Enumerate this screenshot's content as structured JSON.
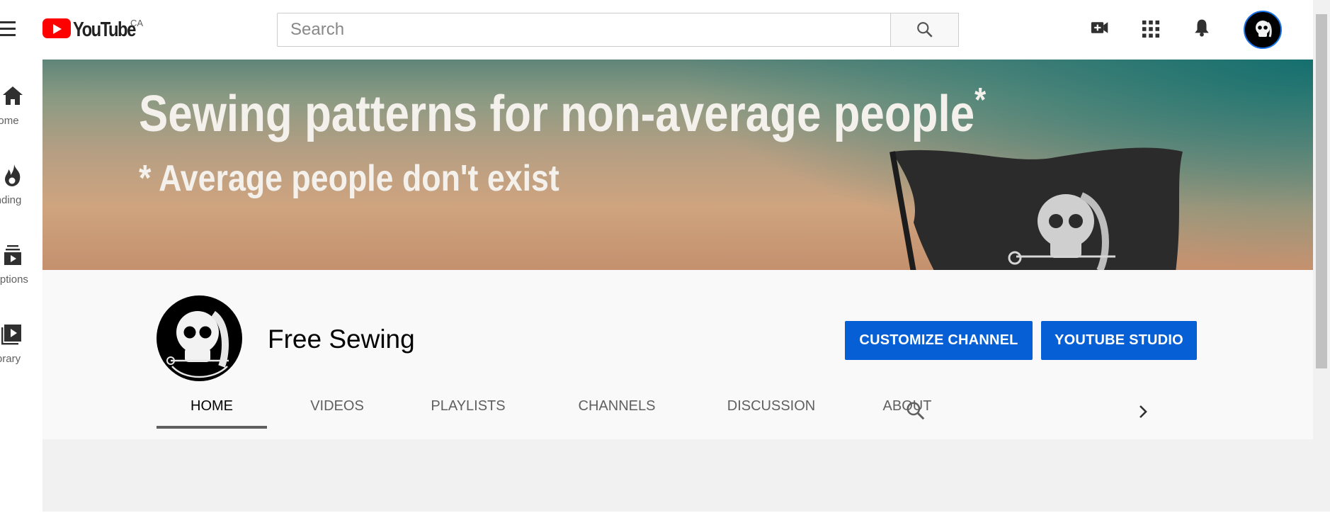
{
  "header": {
    "logo_text": "YouTube",
    "country_code": "CA",
    "search_placeholder": "Search",
    "icons": [
      "menu-icon",
      "search-icon",
      "create-video-icon",
      "apps-grid-icon",
      "notifications-bell-icon",
      "account-avatar"
    ]
  },
  "sidebar": {
    "items": [
      {
        "label": "Home",
        "visible_label": "ome",
        "icon": "home-icon"
      },
      {
        "label": "Trending",
        "visible_label": "nding",
        "icon": "flame-icon"
      },
      {
        "label": "Subscriptions",
        "visible_label": "criptions",
        "icon": "subscriptions-icon"
      },
      {
        "label": "Library",
        "visible_label": "brary",
        "icon": "library-icon"
      }
    ]
  },
  "banner": {
    "title": "Sewing patterns for non-average people",
    "asterisk": "*",
    "subtitle": "* Average people don't exist"
  },
  "channel": {
    "name": "Free Sewing",
    "customize_label": "CUSTOMIZE CHANNEL",
    "studio_label": "YOUTUBE STUDIO",
    "tabs": [
      {
        "label": "HOME",
        "active": true
      },
      {
        "label": "VIDEOS",
        "active": false
      },
      {
        "label": "PLAYLISTS",
        "active": false
      },
      {
        "label": "CHANNELS",
        "active": false
      },
      {
        "label": "DISCUSSION",
        "active": false
      },
      {
        "label": "ABOUT",
        "active": false
      }
    ]
  },
  "colors": {
    "brand_red": "#ff0000",
    "button_blue": "#065fd4",
    "header_bg": "#f9f9f9",
    "content_bg": "#f1f1f1"
  }
}
